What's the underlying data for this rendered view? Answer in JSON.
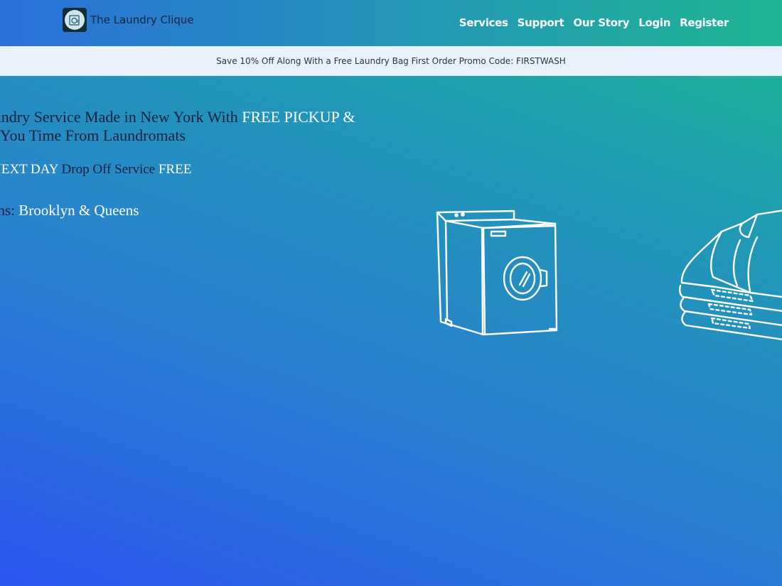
{
  "brand": {
    "name": "The Laundry Clique",
    "logo_icon": "washing-machine-logo-icon"
  },
  "nav": {
    "items": [
      {
        "label": "Services"
      },
      {
        "label": "Support"
      },
      {
        "label": "Our Story"
      },
      {
        "label": "Login"
      },
      {
        "label": "Register"
      }
    ]
  },
  "promo": {
    "text": "Save 10% Off Along With a Free Laundry Bag First Order Promo Code: FIRSTWASH"
  },
  "hero": {
    "line1_text": "aundry Service Made in New York With ",
    "line1_highlight": "FREE PICKUP &",
    "line2_text": "ing You Time From Laundromats",
    "line3_highlight1": "NEXT DAY",
    "line3_text": " Drop Off Service ",
    "line3_highlight2": "FREE",
    "line4_text": "ons: ",
    "line4_highlight": "Brooklyn & Queens"
  },
  "illustrations": {
    "washer_icon": "washing-machine-icon",
    "clothes_icon": "folded-clothes-icon"
  },
  "colors": {
    "accent_text": "#ffffff",
    "body_text": "#11203a",
    "promo_bg": "#e9f2fb"
  }
}
